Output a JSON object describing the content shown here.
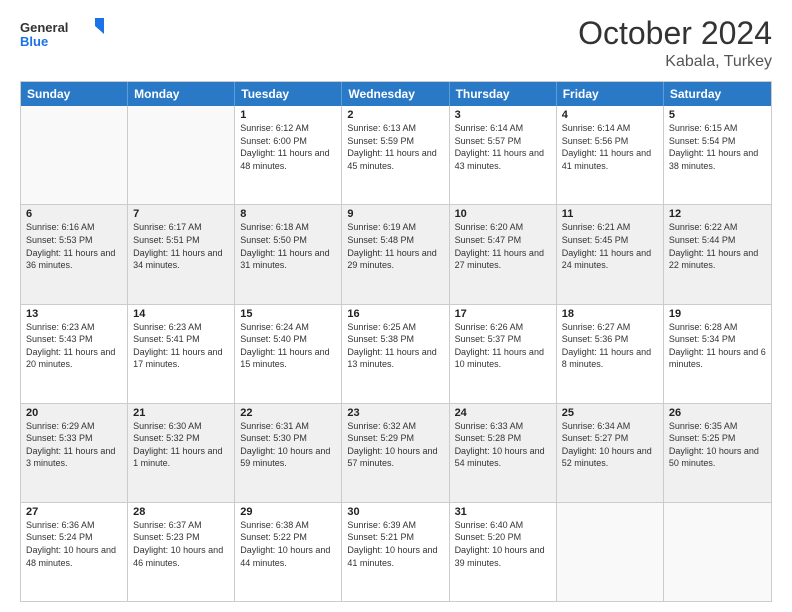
{
  "logo": {
    "general": "General",
    "blue": "Blue"
  },
  "header": {
    "month": "October 2024",
    "location": "Kabala, Turkey"
  },
  "weekdays": [
    "Sunday",
    "Monday",
    "Tuesday",
    "Wednesday",
    "Thursday",
    "Friday",
    "Saturday"
  ],
  "rows": [
    [
      {
        "day": "",
        "sunrise": "",
        "sunset": "",
        "daylight": "",
        "empty": true
      },
      {
        "day": "",
        "sunrise": "",
        "sunset": "",
        "daylight": "",
        "empty": true
      },
      {
        "day": "1",
        "sunrise": "Sunrise: 6:12 AM",
        "sunset": "Sunset: 6:00 PM",
        "daylight": "Daylight: 11 hours and 48 minutes."
      },
      {
        "day": "2",
        "sunrise": "Sunrise: 6:13 AM",
        "sunset": "Sunset: 5:59 PM",
        "daylight": "Daylight: 11 hours and 45 minutes."
      },
      {
        "day": "3",
        "sunrise": "Sunrise: 6:14 AM",
        "sunset": "Sunset: 5:57 PM",
        "daylight": "Daylight: 11 hours and 43 minutes."
      },
      {
        "day": "4",
        "sunrise": "Sunrise: 6:14 AM",
        "sunset": "Sunset: 5:56 PM",
        "daylight": "Daylight: 11 hours and 41 minutes."
      },
      {
        "day": "5",
        "sunrise": "Sunrise: 6:15 AM",
        "sunset": "Sunset: 5:54 PM",
        "daylight": "Daylight: 11 hours and 38 minutes."
      }
    ],
    [
      {
        "day": "6",
        "sunrise": "Sunrise: 6:16 AM",
        "sunset": "Sunset: 5:53 PM",
        "daylight": "Daylight: 11 hours and 36 minutes."
      },
      {
        "day": "7",
        "sunrise": "Sunrise: 6:17 AM",
        "sunset": "Sunset: 5:51 PM",
        "daylight": "Daylight: 11 hours and 34 minutes."
      },
      {
        "day": "8",
        "sunrise": "Sunrise: 6:18 AM",
        "sunset": "Sunset: 5:50 PM",
        "daylight": "Daylight: 11 hours and 31 minutes."
      },
      {
        "day": "9",
        "sunrise": "Sunrise: 6:19 AM",
        "sunset": "Sunset: 5:48 PM",
        "daylight": "Daylight: 11 hours and 29 minutes."
      },
      {
        "day": "10",
        "sunrise": "Sunrise: 6:20 AM",
        "sunset": "Sunset: 5:47 PM",
        "daylight": "Daylight: 11 hours and 27 minutes."
      },
      {
        "day": "11",
        "sunrise": "Sunrise: 6:21 AM",
        "sunset": "Sunset: 5:45 PM",
        "daylight": "Daylight: 11 hours and 24 minutes."
      },
      {
        "day": "12",
        "sunrise": "Sunrise: 6:22 AM",
        "sunset": "Sunset: 5:44 PM",
        "daylight": "Daylight: 11 hours and 22 minutes."
      }
    ],
    [
      {
        "day": "13",
        "sunrise": "Sunrise: 6:23 AM",
        "sunset": "Sunset: 5:43 PM",
        "daylight": "Daylight: 11 hours and 20 minutes."
      },
      {
        "day": "14",
        "sunrise": "Sunrise: 6:23 AM",
        "sunset": "Sunset: 5:41 PM",
        "daylight": "Daylight: 11 hours and 17 minutes."
      },
      {
        "day": "15",
        "sunrise": "Sunrise: 6:24 AM",
        "sunset": "Sunset: 5:40 PM",
        "daylight": "Daylight: 11 hours and 15 minutes."
      },
      {
        "day": "16",
        "sunrise": "Sunrise: 6:25 AM",
        "sunset": "Sunset: 5:38 PM",
        "daylight": "Daylight: 11 hours and 13 minutes."
      },
      {
        "day": "17",
        "sunrise": "Sunrise: 6:26 AM",
        "sunset": "Sunset: 5:37 PM",
        "daylight": "Daylight: 11 hours and 10 minutes."
      },
      {
        "day": "18",
        "sunrise": "Sunrise: 6:27 AM",
        "sunset": "Sunset: 5:36 PM",
        "daylight": "Daylight: 11 hours and 8 minutes."
      },
      {
        "day": "19",
        "sunrise": "Sunrise: 6:28 AM",
        "sunset": "Sunset: 5:34 PM",
        "daylight": "Daylight: 11 hours and 6 minutes."
      }
    ],
    [
      {
        "day": "20",
        "sunrise": "Sunrise: 6:29 AM",
        "sunset": "Sunset: 5:33 PM",
        "daylight": "Daylight: 11 hours and 3 minutes."
      },
      {
        "day": "21",
        "sunrise": "Sunrise: 6:30 AM",
        "sunset": "Sunset: 5:32 PM",
        "daylight": "Daylight: 11 hours and 1 minute."
      },
      {
        "day": "22",
        "sunrise": "Sunrise: 6:31 AM",
        "sunset": "Sunset: 5:30 PM",
        "daylight": "Daylight: 10 hours and 59 minutes."
      },
      {
        "day": "23",
        "sunrise": "Sunrise: 6:32 AM",
        "sunset": "Sunset: 5:29 PM",
        "daylight": "Daylight: 10 hours and 57 minutes."
      },
      {
        "day": "24",
        "sunrise": "Sunrise: 6:33 AM",
        "sunset": "Sunset: 5:28 PM",
        "daylight": "Daylight: 10 hours and 54 minutes."
      },
      {
        "day": "25",
        "sunrise": "Sunrise: 6:34 AM",
        "sunset": "Sunset: 5:27 PM",
        "daylight": "Daylight: 10 hours and 52 minutes."
      },
      {
        "day": "26",
        "sunrise": "Sunrise: 6:35 AM",
        "sunset": "Sunset: 5:25 PM",
        "daylight": "Daylight: 10 hours and 50 minutes."
      }
    ],
    [
      {
        "day": "27",
        "sunrise": "Sunrise: 6:36 AM",
        "sunset": "Sunset: 5:24 PM",
        "daylight": "Daylight: 10 hours and 48 minutes."
      },
      {
        "day": "28",
        "sunrise": "Sunrise: 6:37 AM",
        "sunset": "Sunset: 5:23 PM",
        "daylight": "Daylight: 10 hours and 46 minutes."
      },
      {
        "day": "29",
        "sunrise": "Sunrise: 6:38 AM",
        "sunset": "Sunset: 5:22 PM",
        "daylight": "Daylight: 10 hours and 44 minutes."
      },
      {
        "day": "30",
        "sunrise": "Sunrise: 6:39 AM",
        "sunset": "Sunset: 5:21 PM",
        "daylight": "Daylight: 10 hours and 41 minutes."
      },
      {
        "day": "31",
        "sunrise": "Sunrise: 6:40 AM",
        "sunset": "Sunset: 5:20 PM",
        "daylight": "Daylight: 10 hours and 39 minutes."
      },
      {
        "day": "",
        "sunrise": "",
        "sunset": "",
        "daylight": "",
        "empty": true
      },
      {
        "day": "",
        "sunrise": "",
        "sunset": "",
        "daylight": "",
        "empty": true
      }
    ]
  ]
}
